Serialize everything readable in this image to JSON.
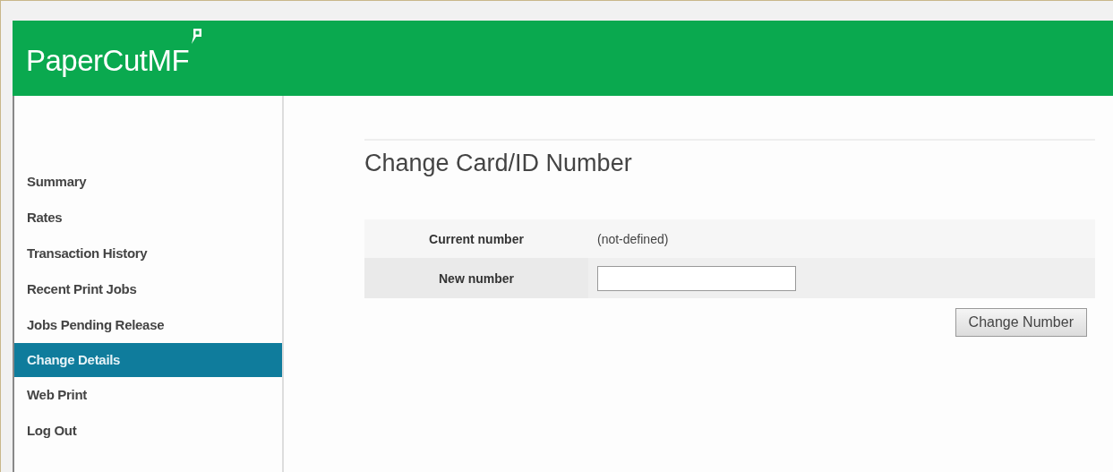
{
  "header": {
    "logo": "PaperCutMF"
  },
  "sidebar": {
    "items": [
      {
        "label": "Summary",
        "selected": false
      },
      {
        "label": "Rates",
        "selected": false
      },
      {
        "label": "Transaction History",
        "selected": false
      },
      {
        "label": "Recent Print Jobs",
        "selected": false
      },
      {
        "label": "Jobs Pending Release",
        "selected": false
      },
      {
        "label": "Change Details",
        "selected": true
      },
      {
        "label": "Web Print",
        "selected": false
      },
      {
        "label": "Log Out",
        "selected": false
      }
    ]
  },
  "main": {
    "title": "Change Card/ID Number",
    "rows": [
      {
        "kind": "text",
        "label": "Current number",
        "value": "(not-defined)"
      },
      {
        "kind": "input",
        "label": "New number"
      }
    ],
    "button": "Change Number"
  }
}
